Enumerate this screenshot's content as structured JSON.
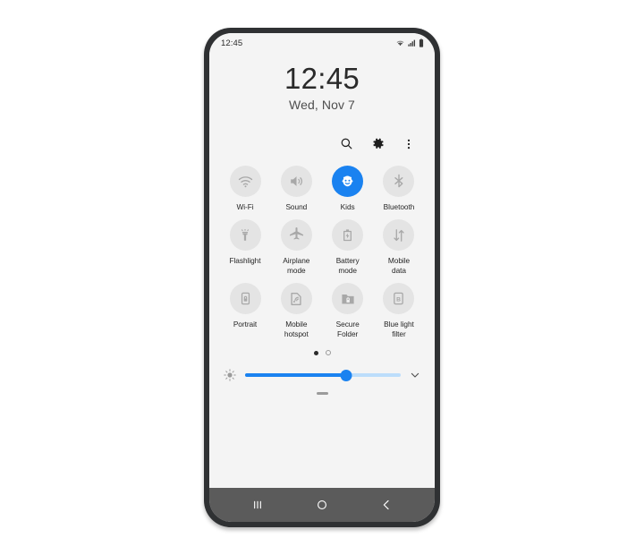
{
  "phone": {
    "frame_color": "#2f3133",
    "screen_bg": "#f4f4f4",
    "accent_color": "#1a82f0"
  },
  "status_bar": {
    "clock": "12:45",
    "icons": [
      "wifi-icon",
      "signal-icon",
      "battery-icon"
    ]
  },
  "lock_clock": {
    "time": "12:45",
    "date": "Wed, Nov 7"
  },
  "action_row": {
    "items": [
      {
        "name": "search-icon",
        "label": "Search"
      },
      {
        "name": "settings-gear-icon",
        "label": "Settings"
      },
      {
        "name": "more-options-icon",
        "label": "More options"
      }
    ]
  },
  "quick_settings": {
    "rows": [
      [
        {
          "label": "Wi-Fi",
          "icon": "wifi-icon",
          "active": false
        },
        {
          "label": "Sound",
          "icon": "sound-icon",
          "active": false
        },
        {
          "label": "Kids",
          "icon": "kids-face-icon",
          "active": true
        },
        {
          "label": "Bluetooth",
          "icon": "bluetooth-icon",
          "active": false
        }
      ],
      [
        {
          "label": "Flashlight",
          "icon": "flashlight-icon",
          "active": false
        },
        {
          "label": "Airplane\nmode",
          "icon": "airplane-icon",
          "active": false
        },
        {
          "label": "Battery\nmode",
          "icon": "battery-mode-icon",
          "active": false
        },
        {
          "label": "Mobile\ndata",
          "icon": "mobile-data-icon",
          "active": false
        }
      ],
      [
        {
          "label": "Portrait",
          "icon": "screen-rotation-lock-icon",
          "active": false
        },
        {
          "label": "Mobile\nhotspot",
          "icon": "hotspot-icon",
          "active": false
        },
        {
          "label": "Secure\nFolder",
          "icon": "secure-folder-icon",
          "active": false
        },
        {
          "label": "Blue light\nfilter",
          "icon": "blue-light-filter-icon",
          "active": false
        }
      ]
    ]
  },
  "pagination": {
    "pages": 2,
    "active_page": 1
  },
  "brightness": {
    "icon": "brightness-icon",
    "value_percent": 65,
    "expand_icon": "chevron-down-icon"
  },
  "panel_handle": {
    "name": "panel-drag-handle"
  },
  "nav_bar": {
    "buttons": [
      {
        "name": "recent-apps-icon",
        "label": "Recents"
      },
      {
        "name": "home-icon",
        "label": "Home"
      },
      {
        "name": "back-icon",
        "label": "Back"
      }
    ]
  }
}
